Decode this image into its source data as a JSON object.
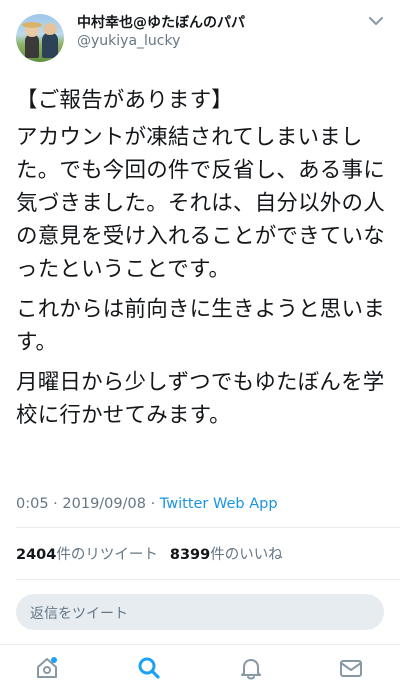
{
  "user": {
    "display_name": "中村幸也@ゆたぼんのパパ",
    "handle": "@yukiya_lucky"
  },
  "tweet": {
    "title": "【ご報告があります】",
    "paragraphs": [
      "アカウントが凍結されてしまいました。でも今回の件で反省し、ある事に気づきました。それは、自分以外の人の意見を受け入れることができていなったということです。",
      "これからは前向きに生きようと思います。",
      "月曜日から少しずつでもゆたぼんを学校に行かせてみます。"
    ],
    "time": "0:05",
    "separator": "·",
    "date": "2019/09/08",
    "source": "Twitter Web App"
  },
  "stats": {
    "retweets_count": "2404",
    "retweets_label": "件のリツイート",
    "likes_count": "8399",
    "likes_label": "件のいいね"
  },
  "reply": {
    "placeholder": "返信をツイート"
  },
  "colors": {
    "accent": "#1b95e0",
    "text": "#14171a",
    "muted": "#657786",
    "reply_bg": "#e6ecf0"
  },
  "tabbar": {
    "icons": [
      "home-icon",
      "search-icon",
      "notifications-icon",
      "messages-icon"
    ],
    "active": "search-icon"
  }
}
